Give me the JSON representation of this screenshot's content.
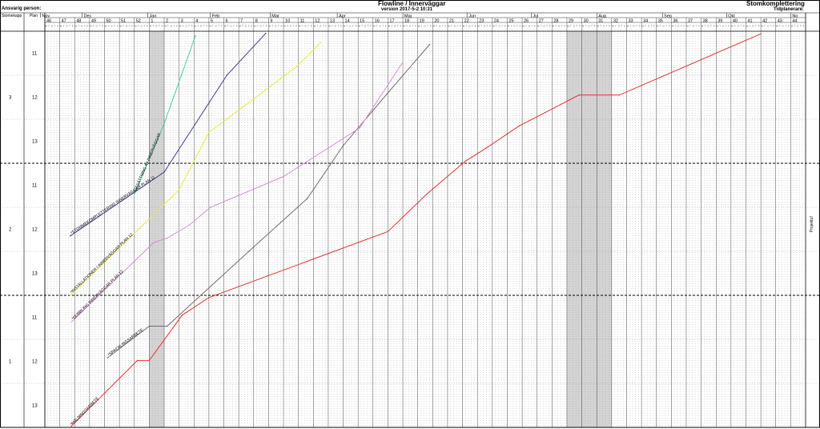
{
  "header": {
    "person_label": "Ansvarig person:",
    "title": "Flowline / Innerväggar",
    "version": "version 2017-5-2 10:31",
    "project": "Stomkomplettering",
    "scheduler_label": "Tidplanerare:",
    "project_side": "Projektuf"
  },
  "table": {
    "col_stage": "Stomekapp",
    "col_floor": "Plan"
  },
  "colors": {
    "malning": "#e0322e",
    "spackling": "#7a6a6a",
    "dubbling": "#d98be0",
    "installationer": "#e8e83a",
    "utsattning": "#40d0a0",
    "stomme": "#3a3a8a",
    "grid_dot": "#9a9a9a",
    "holiday": "#d4d4d4"
  },
  "chart_data": {
    "type": "line",
    "x_unit": "week",
    "months": [
      {
        "label": "Nov",
        "w": 45.7
      },
      {
        "label": "Dec",
        "w": 48.5
      },
      {
        "label": "Jan",
        "w": 52.9
      },
      {
        "label": "Feb",
        "w": 57.1
      },
      {
        "label": "Mar",
        "w": 61.1
      },
      {
        "label": "Apr",
        "w": 65.6
      },
      {
        "label": "Maj",
        "w": 70.0
      },
      {
        "label": "Jun",
        "w": 74.3
      },
      {
        "label": "Jul",
        "w": 78.6
      },
      {
        "label": "Aug",
        "w": 83.0
      },
      {
        "label": "Sep",
        "w": 87.4
      },
      {
        "label": "Okt",
        "w": 91.7
      },
      {
        "label": "No",
        "w": 96.0
      }
    ],
    "weeks": [
      46,
      47,
      48,
      49,
      50,
      51,
      52,
      1,
      2,
      3,
      4,
      5,
      6,
      7,
      8,
      9,
      10,
      11,
      12,
      13,
      14,
      15,
      16,
      17,
      18,
      19,
      20,
      21,
      22,
      23,
      24,
      25,
      26,
      27,
      28,
      29,
      30,
      31,
      32,
      33,
      34,
      35,
      36,
      37,
      38,
      39,
      40,
      41,
      42,
      43,
      44
    ],
    "week_start": 46,
    "holidays": [
      [
        53,
        54
      ],
      [
        81,
        84
      ]
    ],
    "stages": [
      {
        "stage": "3",
        "floors": [
          "11",
          "12",
          "13"
        ]
      },
      {
        "stage": "2",
        "floors": [
          "11",
          "12",
          "13"
        ]
      },
      {
        "stage": "1",
        "floors": [
          "11",
          "12",
          "13"
        ]
      }
    ],
    "series": [
      {
        "name": "*MÅLNINGSARBETE",
        "color_key": "malning",
        "points": [
          [
            47.7,
            0
          ],
          [
            52.2,
            1.52
          ],
          [
            53.0,
            1.52
          ],
          [
            55.2,
            2.55
          ],
          [
            57.0,
            2.95
          ],
          [
            69.0,
            4.45
          ],
          [
            71.6,
            5.3
          ],
          [
            74.2,
            6.05
          ],
          [
            75.6,
            6.35
          ],
          [
            77.8,
            6.85
          ],
          [
            81.8,
            7.55
          ],
          [
            84.5,
            7.55
          ],
          [
            94.0,
            8.94
          ]
        ]
      },
      {
        "name": "*SPACKLINGSARBETE",
        "color_key": "spackling",
        "points": [
          [
            50.2,
            1.58
          ],
          [
            53.0,
            2.3
          ],
          [
            54.2,
            2.3
          ],
          [
            60.0,
            4.1
          ],
          [
            63.6,
            5.2
          ],
          [
            66.0,
            6.4
          ],
          [
            69.0,
            7.6
          ],
          [
            71.8,
            8.7
          ]
        ]
      },
      {
        "name": "*DUBBLING INNERVÄGGAR PLAN 12",
        "color_key": "dubbling",
        "points": [
          [
            47.8,
            2.4
          ],
          [
            53.3,
            4.2
          ],
          [
            54.2,
            4.3
          ],
          [
            55.7,
            4.6
          ],
          [
            57.1,
            5.0
          ],
          [
            62.0,
            5.7
          ],
          [
            67.1,
            6.8
          ],
          [
            70.0,
            8.3
          ]
        ]
      },
      {
        "name": "*INSTALLATIONER I INNERVÄGGAR PLAN 12",
        "color_key": "installationer",
        "points": [
          [
            47.7,
            3.0
          ],
          [
            53.2,
            4.8
          ],
          [
            55.0,
            5.4
          ],
          [
            57.0,
            6.7
          ],
          [
            62.9,
            8.2
          ],
          [
            64.5,
            8.75
          ]
        ]
      },
      {
        "name": "*UTSÄTTNING AV INNERVÄGGAR",
        "color_key": "utsattning",
        "points": [
          [
            52.0,
            5.3
          ],
          [
            54.0,
            6.9
          ],
          [
            56.1,
            8.9
          ]
        ]
      },
      {
        "name": "*STOMMEKOMPLETTERING INNERVÄGGAR PLAN 11",
        "color_key": "stomme",
        "points": [
          [
            47.7,
            4.35
          ],
          [
            54.0,
            5.8
          ],
          [
            58.2,
            8.0
          ],
          [
            60.8,
            8.95
          ]
        ]
      }
    ]
  }
}
